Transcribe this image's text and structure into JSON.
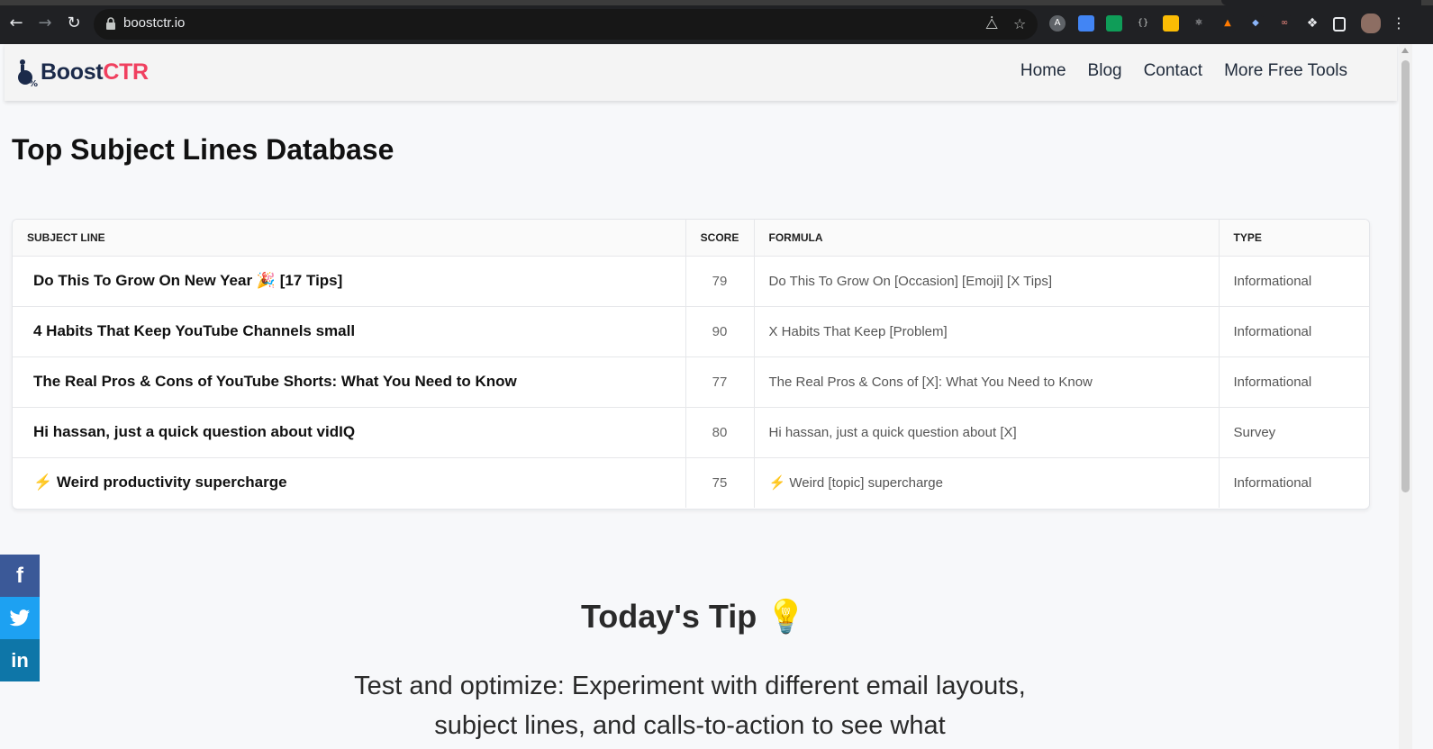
{
  "browser": {
    "url": "boostctr.io"
  },
  "header": {
    "logo_prefix": "Boost",
    "logo_suffix": "CTR",
    "nav": [
      "Home",
      "Blog",
      "Contact",
      "More Free Tools"
    ]
  },
  "page": {
    "title": "Top Subject Lines Database"
  },
  "table": {
    "columns": [
      "SUBJECT LINE",
      "SCORE",
      "FORMULA",
      "TYPE"
    ],
    "rows": [
      {
        "subject": "Do This To Grow On New Year 🎉 [17 Tips]",
        "score": "79",
        "formula": "Do This To Grow On [Occasion] [Emoji] [X Tips]",
        "type": "Informational"
      },
      {
        "subject": "4 Habits That Keep YouTube Channels small",
        "score": "90",
        "formula": "X Habits That Keep [Problem]",
        "type": "Informational"
      },
      {
        "subject": "The Real Pros & Cons of YouTube Shorts: What You Need to Know",
        "score": "77",
        "formula": "The Real Pros & Cons of [X]: What You Need to Know",
        "type": "Informational"
      },
      {
        "subject": "Hi hassan, just a quick question about vidIQ",
        "score": "80",
        "formula": "Hi hassan, just a quick question about [X]",
        "type": "Survey"
      },
      {
        "subject": "⚡ Weird productivity supercharge",
        "score": "75",
        "formula": "⚡ Weird [topic] supercharge",
        "type": "Informational"
      }
    ]
  },
  "tip": {
    "title": "Today's Tip 💡",
    "body": "Test and optimize: Experiment with different email layouts, subject lines, and calls-to-action to see what"
  },
  "social": {
    "facebook": "f",
    "linkedin": "in"
  },
  "colors": {
    "brand": "#1b2a4a",
    "accent": "#f0405f",
    "facebook": "#3b5998",
    "twitter": "#1da1f2",
    "linkedin": "#0e76a8"
  }
}
